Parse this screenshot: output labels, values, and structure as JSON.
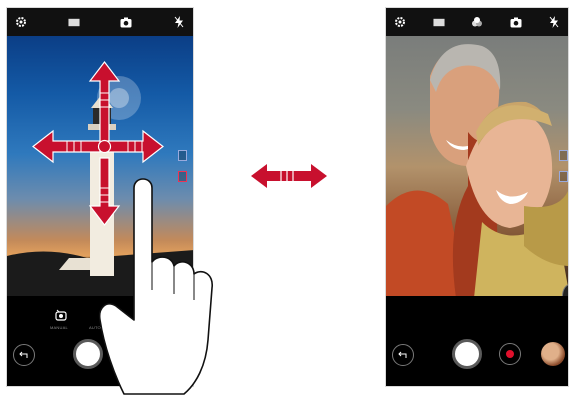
{
  "screens": {
    "left": {
      "topbar": {
        "icons": [
          "gear-icon",
          "aspect-ratio-icon",
          "switch-camera-icon",
          "flash-off-icon"
        ]
      },
      "modes": [
        "MANUAL",
        "AUTO"
      ]
    },
    "right": {
      "topbar": {
        "icons": [
          "gear-icon",
          "aspect-ratio-icon",
          "filter-icon",
          "switch-camera-icon",
          "flash-off-icon"
        ]
      }
    }
  },
  "colors": {
    "accent": "#c8102e",
    "record": "#e0102c",
    "bar": "#000000"
  }
}
